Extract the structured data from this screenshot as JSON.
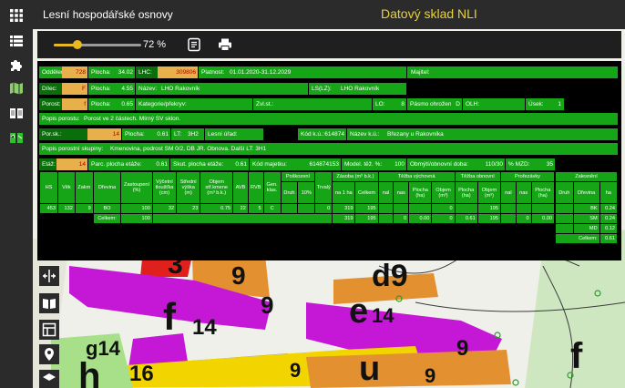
{
  "header": {
    "app_title": "Lesní hospodářské osnovy",
    "store_title": "Datový sklad NLI"
  },
  "rail": {
    "icons": [
      "apps-icon",
      "list-icon",
      "puzzle-icon",
      "map-icon",
      "book-icon",
      "map-book-icon"
    ]
  },
  "toolbar": {
    "zoom_percent": "72 %",
    "zoom_level": 0.27
  },
  "panel": {
    "r1": {
      "oddeleni_l": "Oddělení:",
      "oddeleni_v": "728",
      "plocha_l": "Plocha:",
      "plocha_v": "34.02",
      "lhc_l": "LHC:",
      "lhc_v": "309806",
      "platnost_l": "Platnost:",
      "platnost_v": "01.01.2020-31.12.2029",
      "majitel_l": "Majitel:"
    },
    "r2": {
      "dilec_l": "Dílec:",
      "dilec_v": "F",
      "plocha_l": "Plocha:",
      "plocha_v": "4.55",
      "nazev_l": "Název:",
      "nazev_v": "LHO Rakovník",
      "ls_l": "LS(LZ):",
      "ls_v": "LHO Rakovník"
    },
    "r3": {
      "porost_l": "Porost:",
      "porost_v": "f",
      "plocha_l": "Plocha:",
      "plocha_v": "0.65",
      "kat_l": "Kategorie/překryv:",
      "zvl_l": "Zvl.st.:",
      "lo_l": "LO:",
      "lo_v": "8",
      "pasmo_l": "Pásmo ohrožení:",
      "pasmo_v": "D",
      "olh_l": "OLH:",
      "usek_l": "Úsek:",
      "usek_v": "1"
    },
    "r4": {
      "popis_l": "Popis porostu:",
      "popis_v": "Porost ve 2 částech. Mírný SV sklon."
    },
    "r5": {
      "porsk_l": "Por.sk.:",
      "porsk_v": "14",
      "plocha_l": "Plocha:",
      "plocha_v": "0.61",
      "lt_l": "LT:",
      "lt_v": "3H2",
      "urad_l": "Lesní úřad:",
      "kodku_l": "Kód k.ú.:",
      "kodku_v": "614874",
      "nazku_l": "Název k.ú.:",
      "nazku_v": "Březany u Rakovníka"
    },
    "r6": {
      "skup_l": "Popis porostní skupiny:",
      "skup_v": "Kmenovina, podrost SM 0/2, DB JR. Obnova. Další LT: 3H1"
    },
    "r7": {
      "etaz_l": "Etáž:",
      "etaz_v": "14",
      "parc_l": "Parc. plocha etáže:",
      "parc_v": "0.61",
      "skut_l": "Skut. plocha etáže:",
      "skut_v": "0.61",
      "kodmaj_l": "Kód majetku:",
      "kodmaj_v": "614874153",
      "model_l": "Model. těž. %:",
      "model_v": "100",
      "obmyti_l": "Obmýtí/obnovní doba:",
      "obmyti_v": "110/30",
      "mzd_l": "% MZD:",
      "mzd_v": "35"
    }
  },
  "grid": {
    "h1": {
      "hs": "HS",
      "vek": "Věk",
      "zakm": "Zakm",
      "drevina": "Dřevina",
      "zastoupeni": "Zastoupení (%)",
      "vycetni": "Výčetní tloušťka (cm)",
      "stredni": "Střední výška (m)",
      "objem": "Objem stř.kmene (m³ b.k.)",
      "avb": "AVB",
      "rvb": "RVB",
      "gen": "Gen. klas.",
      "poskozeni": "Poškození",
      "poskozeni_druh": "Druh",
      "poskozeni_pct": "10%",
      "trvaly": "Trvalý",
      "zasoba": "Zásoba (m³ b.k.)",
      "zasoba_na1ha": "na 1 ha",
      "zasoba_celkem": "Celkem",
      "tezba_vych": "Těžba výchovná",
      "tv_nal": "nal",
      "tv_nas": "nas",
      "tv_plocha": "Plocha (ha)",
      "tv_objem": "Objem (m³)",
      "tezba_obn": "Těžba obnovní",
      "to_plocha": "Plocha (ha)",
      "to_objem": "Objem (m³)",
      "prorezavky": "Prořezávky",
      "pr_nal": "nal",
      "pr_nas": "nas",
      "pr_plocha": "Plocha (ha)",
      "zalesneni": "Zalesnění",
      "za_druh": "Druh",
      "za_drevina": "Dřevina",
      "za_ha": "ha"
    },
    "row": {
      "hs": "453",
      "vek": "132",
      "zakm": "9",
      "drevina": "BO",
      "zast": "100",
      "vyc": "32",
      "str": "23",
      "obj": "0.75",
      "avb": "22",
      "rvb": "5",
      "gen": "C",
      "trv": "0",
      "na1ha": "319",
      "celkem": "195",
      "tv_obj": "0",
      "to_obj": "195"
    },
    "total": {
      "label": "Celkem:",
      "zast": "100",
      "na1ha": "319",
      "celkem": "195",
      "tv_nas": "0",
      "tv_plocha": "0.00",
      "tv_obj": "0",
      "to_plocha": "0.61",
      "to_obj": "195",
      "pr_nas": "0",
      "pr_plocha": "0.00"
    },
    "zal": [
      {
        "drevina": "BK",
        "ha": "0.24"
      },
      {
        "drevina": "SM",
        "ha": "0.24"
      },
      {
        "drevina": "MD",
        "ha": "0.12"
      }
    ],
    "zal_total": {
      "label": "Celkem:",
      "ha": "0.61"
    }
  },
  "map": {
    "labels": [
      "3",
      "9",
      "d9",
      "f",
      "14",
      "e",
      "14",
      "g14",
      "h",
      "16",
      "9",
      "u",
      "9",
      "f",
      "9",
      "9"
    ]
  },
  "colors": {
    "panel_green": "#16a516",
    "dark_green": "#0a6f0a",
    "value_box": "#e8b04a",
    "accent_yellow": "#e8d23a",
    "zoom_yellow": "#e8b923",
    "topbar": "#2b2b2b"
  }
}
